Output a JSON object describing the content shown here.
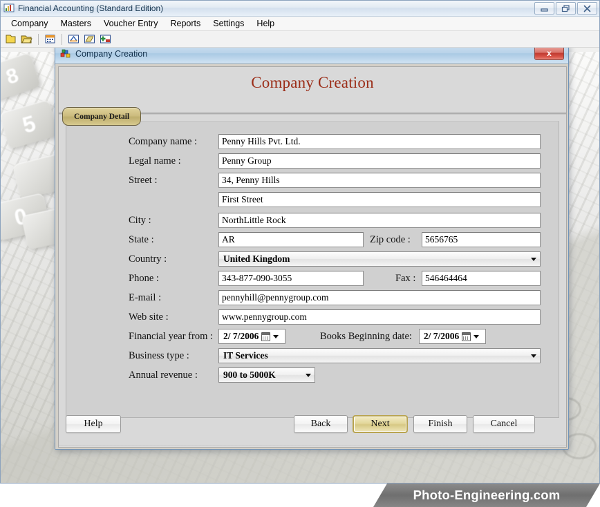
{
  "app": {
    "title": "Financial Accounting (Standard Edition)",
    "icon": "chart-accounting-icon",
    "window_controls": {
      "minimize": "minimize-icon",
      "restore": "restore-icon",
      "close": "close-icon"
    }
  },
  "menubar": {
    "items": [
      {
        "label": "Company"
      },
      {
        "label": "Masters"
      },
      {
        "label": "Voucher Entry"
      },
      {
        "label": "Reports"
      },
      {
        "label": "Settings"
      },
      {
        "label": "Help"
      }
    ]
  },
  "toolbar": {
    "buttons": [
      {
        "name": "new-company-icon",
        "tooltip": "New"
      },
      {
        "name": "open-folder-icon",
        "tooltip": "Open"
      },
      {
        "name": "calendar-icon",
        "tooltip": "Calendar"
      },
      {
        "name": "balance-scale-icon",
        "tooltip": "Trial Balance"
      },
      {
        "name": "ledger-book-icon",
        "tooltip": "Ledger"
      },
      {
        "name": "add-chart-icon",
        "tooltip": "Add"
      }
    ]
  },
  "dialog": {
    "titlebar": {
      "icon": "company-creation-icon",
      "title": "Company Creation",
      "close_label": "x"
    },
    "heading": "Company Creation",
    "tabs": [
      {
        "label": "Company Detail",
        "active": true
      }
    ],
    "fields": {
      "company_name": {
        "label": "Company name :",
        "value": "Penny Hills Pvt. Ltd."
      },
      "legal_name": {
        "label": "Legal name :",
        "value": "Penny Group"
      },
      "street": {
        "label": "Street :",
        "value": "34, Penny Hills"
      },
      "street2": {
        "label": "",
        "value": "First Street"
      },
      "city": {
        "label": "City :",
        "value": "NorthLittle Rock"
      },
      "state": {
        "label": "State :",
        "value": "AR"
      },
      "zip_code": {
        "label": "Zip code :",
        "value": "5656765"
      },
      "country": {
        "label": "Country :",
        "value": "United Kingdom"
      },
      "phone": {
        "label": "Phone :",
        "value": "343-877-090-3055"
      },
      "fax": {
        "label": "Fax :",
        "value": "546464464"
      },
      "email": {
        "label": "E-mail :",
        "value": "pennyhill@pennygroup.com"
      },
      "website": {
        "label": "Web site :",
        "value": "www.pennygroup.com"
      },
      "financial_year_from": {
        "label": "Financial year from :",
        "value": "2/  7/2006"
      },
      "books_beginning_date": {
        "label": "Books Beginning date:",
        "value": "2/  7/2006"
      },
      "business_type": {
        "label": "Business type :",
        "value": "IT Services"
      },
      "annual_revenue": {
        "label": "Annual revenue :",
        "value": "900 to 5000K"
      }
    },
    "buttons": {
      "help": "Help",
      "back": "Back",
      "next": "Next",
      "finish": "Finish",
      "cancel": "Cancel"
    }
  },
  "watermark": {
    "text": "Photo-Engineering.com"
  },
  "colors": {
    "heading": "#9b2d18",
    "tab_active": "#cdbd80",
    "primary_button": "#e2d69a",
    "dialog_title_bar": "#b9d3e9",
    "close_button": "#c0392f"
  }
}
